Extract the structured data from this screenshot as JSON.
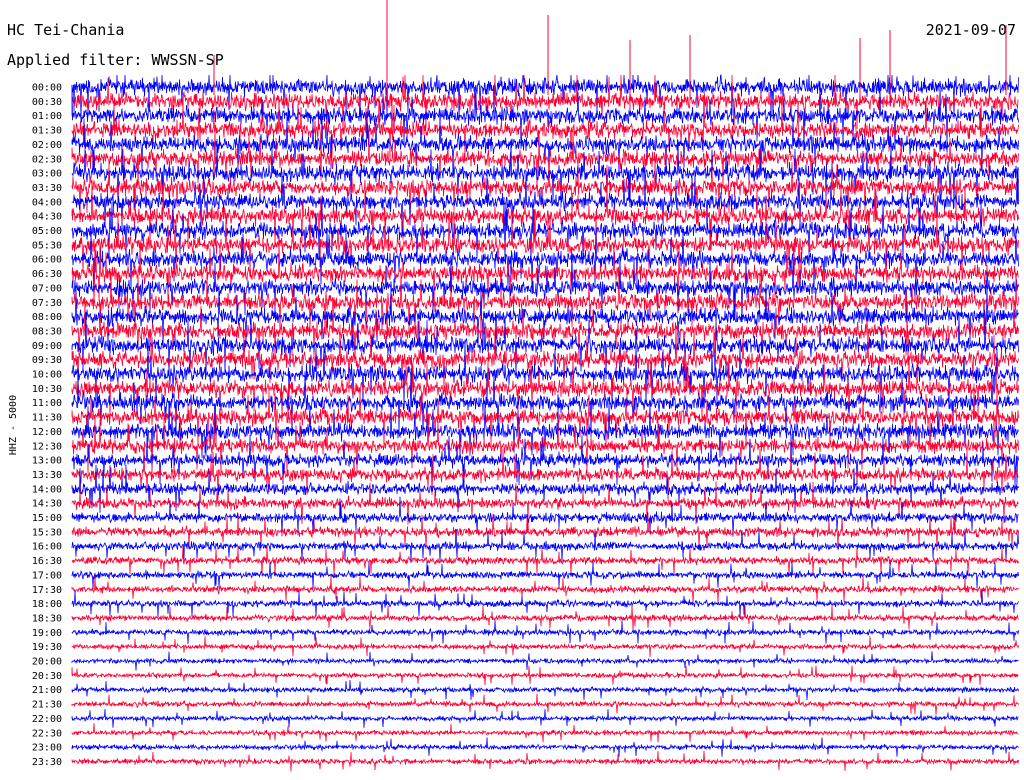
{
  "header": {
    "station": "HC Tei-Chania",
    "date": "2021-09-07",
    "filter": "Applied filter: WWSSN-SP"
  },
  "chart_data": {
    "type": "line",
    "title": "HC Tei-Chania",
    "ylabel": "HHZ - 5000",
    "row_labels": [
      "00:00",
      "00:30",
      "01:00",
      "01:30",
      "02:00",
      "02:30",
      "03:00",
      "03:30",
      "04:00",
      "04:30",
      "05:00",
      "05:30",
      "06:00",
      "06:30",
      "07:00",
      "07:30",
      "08:00",
      "08:30",
      "09:00",
      "09:30",
      "10:00",
      "10:30",
      "11:00",
      "11:30",
      "12:00",
      "12:30",
      "13:00",
      "13:30",
      "14:00",
      "14:30",
      "15:00",
      "15:30",
      "16:00",
      "16:30",
      "17:00",
      "17:30",
      "18:00",
      "18:30",
      "19:00",
      "19:30",
      "20:00",
      "20:30",
      "21:00",
      "21:30",
      "22:00",
      "22:30",
      "23:00",
      "23:30"
    ],
    "trace_colors": [
      "#0000ff",
      "#ff0033"
    ],
    "amplitude_profile": [
      1.0,
      1.0,
      1.0,
      1.0,
      1.0,
      1.0,
      1.0,
      1.0,
      1.0,
      1.0,
      1.0,
      1.0,
      1.0,
      1.0,
      1.0,
      1.0,
      1.0,
      1.0,
      1.0,
      1.0,
      1.0,
      1.0,
      1.0,
      0.95,
      0.9,
      0.85,
      0.8,
      0.75,
      0.7,
      0.65,
      0.6,
      0.55,
      0.5,
      0.45,
      0.42,
      0.4,
      0.38,
      0.36,
      0.34,
      0.3,
      0.28,
      0.28,
      0.3,
      0.3,
      0.28,
      0.28,
      0.28,
      0.3
    ]
  }
}
